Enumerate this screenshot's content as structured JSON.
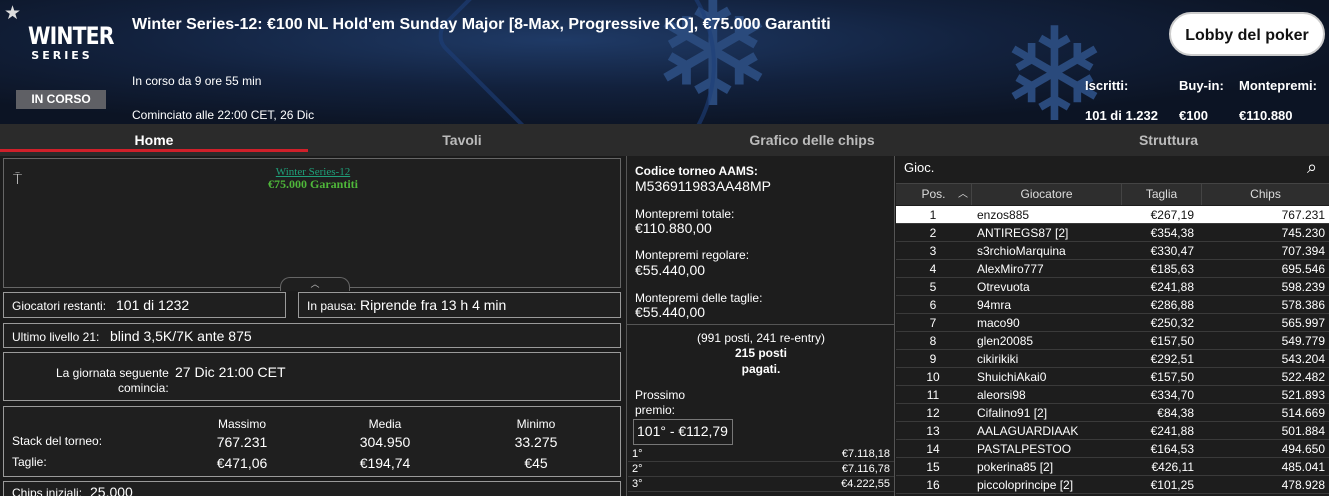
{
  "header": {
    "logo_top": "WINTER",
    "logo_bottom": "SERIES",
    "status_badge": "IN CORSO",
    "title": "Winter Series-12: €100 NL Hold'em Sunday Major [8-Max, Progressive KO], €75.000 Garantiti",
    "running": "In corso da 9 ore 55 min",
    "started": "Cominciato alle 22:00 CET, 26 Dic",
    "lobby_button": "Lobby del poker",
    "entrants_label": "Iscritti:",
    "entrants_value": "101 di 1.232",
    "buyin_label": "Buy-in:",
    "buyin_value": "€100",
    "prizepool_label": "Montepremi:",
    "prizepool_value": "€110.880"
  },
  "tabs": [
    "Home",
    "Tavoli",
    "Grafico delle chips",
    "Struttura"
  ],
  "left": {
    "banner_line1": "Winter Series-12",
    "banner_line2": "€75.000 Garantiti",
    "players_left_label": "Giocatori restanti:",
    "players_left_value": "101 di 1232",
    "pause_label": "In pausa:",
    "pause_value": "Riprende fra 13 h 4 min",
    "level_label": "Ultimo livello 21:",
    "level_value": "blind 3,5K/7K ante 875",
    "next_day_label_1": "La giornata seguente",
    "next_day_label_2": "comincia:",
    "next_day_value": "27 Dic 21:00 CET",
    "stats_headers": [
      "Massimo",
      "Media",
      "Minimo"
    ],
    "stack_label": "Stack del torneo:",
    "stack_values": [
      "767.231",
      "304.950",
      "33.275"
    ],
    "bounty_label": "Taglie:",
    "bounty_values": [
      "€471,06",
      "€194,74",
      "€45"
    ],
    "initial_chips_label": "Chips iniziali:",
    "initial_chips_value": "25.000"
  },
  "middle": {
    "aams_label": "Codice torneo AAMS:",
    "aams_value": "M536911983AA48MP",
    "total_label": "Montepremi totale:",
    "total_value": "€110.880,00",
    "regular_label": "Montepremi regolare:",
    "regular_value": "€55.440,00",
    "bounty_label": "Montepremi delle taglie:",
    "bounty_value": "€55.440,00",
    "paid_line1": "(991 posti, 241 re-entry)",
    "paid_line2": "215 posti",
    "paid_line3": "pagati.",
    "next_prize_label_1": "Prossimo",
    "next_prize_label_2": "premio:",
    "next_prize_value": "101° - €112,79",
    "prizes": [
      [
        "1°",
        "€7.118,18"
      ],
      [
        "2°",
        "€7.116,78"
      ],
      [
        "3°",
        "€4.222,55"
      ]
    ]
  },
  "players": {
    "search_label": "Gioc.",
    "columns": [
      "Pos.",
      "Giocatore",
      "Taglia",
      "Chips"
    ],
    "rows": [
      [
        "1",
        "enzos885",
        "€267,19",
        "767.231"
      ],
      [
        "2",
        "ANTIREGS87 [2]",
        "€354,38",
        "745.230"
      ],
      [
        "3",
        "s3rchioMarquina",
        "€330,47",
        "707.394"
      ],
      [
        "4",
        "AlexMiro777",
        "€185,63",
        "695.546"
      ],
      [
        "5",
        "Otrevuota",
        "€241,88",
        "598.239"
      ],
      [
        "6",
        "94mra",
        "€286,88",
        "578.386"
      ],
      [
        "7",
        "maco90",
        "€250,32",
        "565.997"
      ],
      [
        "8",
        "glen20085",
        "€157,50",
        "549.779"
      ],
      [
        "9",
        "cikirikiki",
        "€292,51",
        "543.204"
      ],
      [
        "10",
        "ShuichiAkai0",
        "€157,50",
        "522.482"
      ],
      [
        "11",
        "aleorsi98",
        "€334,70",
        "521.893"
      ],
      [
        "12",
        "Cifalino91 [2]",
        "€84,38",
        "514.669"
      ],
      [
        "13",
        "AALAGUARDIAAK",
        "€241,88",
        "501.884"
      ],
      [
        "14",
        "PASTALPESTOO",
        "€164,53",
        "494.650"
      ],
      [
        "15",
        "pokerina85 [2]",
        "€426,11",
        "485.041"
      ],
      [
        "16",
        "piccoloprincipe [2]",
        "€101,25",
        "478.928"
      ]
    ]
  }
}
